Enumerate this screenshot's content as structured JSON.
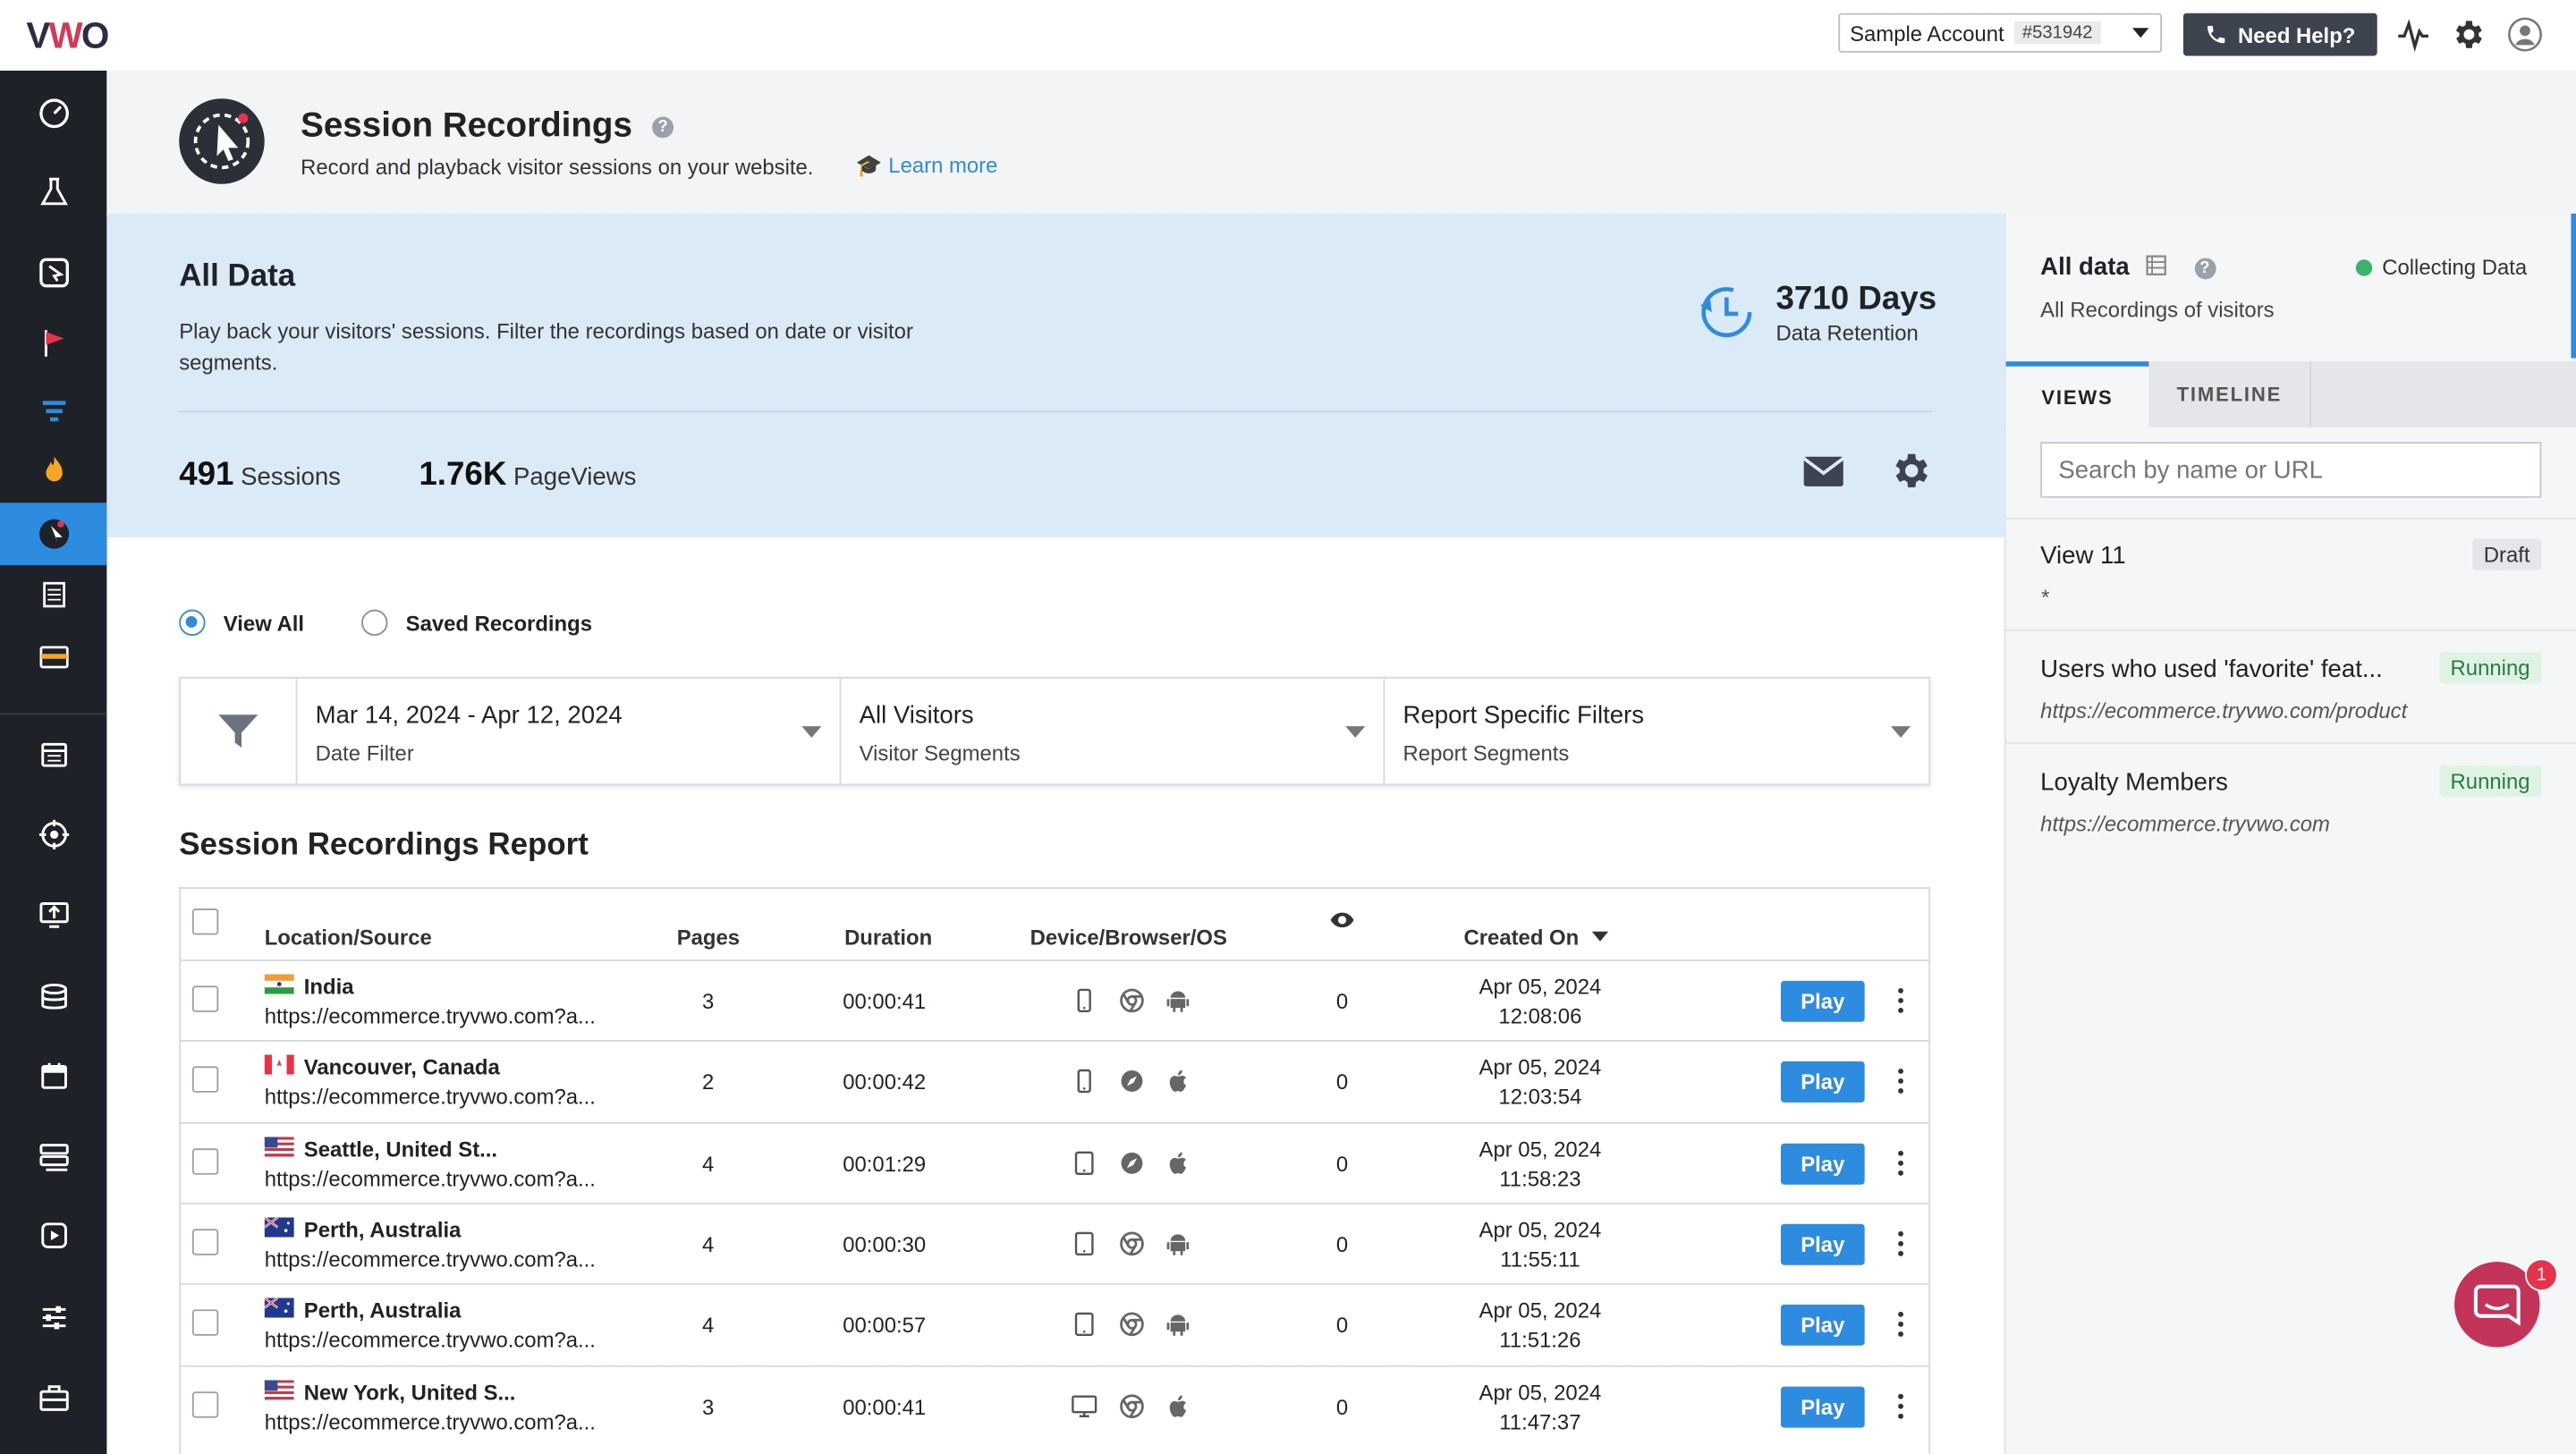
{
  "topbar": {
    "logo": "VWO",
    "account_name": "Sample Account",
    "account_id": "#531942",
    "help_label": "Need Help?"
  },
  "header": {
    "title": "Session Recordings",
    "help_icon": "?",
    "subtitle": "Record and playback visitor sessions on your website.",
    "learn_more": "Learn more"
  },
  "all_data": {
    "title": "All Data",
    "description": "Play back your visitors' sessions. Filter the recordings based on date or visitor segments.",
    "retention_value": "3710 Days",
    "retention_label": "Data Retention",
    "sessions_value": "491",
    "sessions_label": "Sessions",
    "pageviews_value": "1.76K",
    "pageviews_label": "PageViews"
  },
  "radios": {
    "view_all": "View All",
    "saved": "Saved Recordings"
  },
  "filters": [
    {
      "value": "Mar 14, 2024 - Apr 12, 2024",
      "label": "Date Filter"
    },
    {
      "value": "All Visitors",
      "label": "Visitor Segments"
    },
    {
      "value": "Report Specific Filters",
      "label": "Report Segments"
    }
  ],
  "report": {
    "title": "Session Recordings Report",
    "columns": {
      "location": "Location/Source",
      "pages": "Pages",
      "duration": "Duration",
      "device": "Device/Browser/OS",
      "created": "Created On"
    },
    "play_label": "Play",
    "rows": [
      {
        "location": "India",
        "source": "https://ecommerce.tryvwo.com?a...",
        "pages": "3",
        "duration": "00:00:41",
        "views": "0",
        "date": "Apr 05, 2024",
        "time": "12:08:06",
        "flag": "in",
        "device": "mobile",
        "browser": "chrome",
        "os": "android"
      },
      {
        "location": "Vancouver, Canada",
        "source": "https://ecommerce.tryvwo.com?a...",
        "pages": "2",
        "duration": "00:00:42",
        "views": "0",
        "date": "Apr 05, 2024",
        "time": "12:03:54",
        "flag": "ca",
        "device": "mobile",
        "browser": "safari",
        "os": "apple"
      },
      {
        "location": "Seattle, United St...",
        "source": "https://ecommerce.tryvwo.com?a...",
        "pages": "4",
        "duration": "00:01:29",
        "views": "0",
        "date": "Apr 05, 2024",
        "time": "11:58:23",
        "flag": "us",
        "device": "tablet",
        "browser": "safari",
        "os": "apple"
      },
      {
        "location": "Perth, Australia",
        "source": "https://ecommerce.tryvwo.com?a...",
        "pages": "4",
        "duration": "00:00:30",
        "views": "0",
        "date": "Apr 05, 2024",
        "time": "11:55:11",
        "flag": "au",
        "device": "tablet",
        "browser": "chrome",
        "os": "android"
      },
      {
        "location": "Perth, Australia",
        "source": "https://ecommerce.tryvwo.com?a...",
        "pages": "4",
        "duration": "00:00:57",
        "views": "0",
        "date": "Apr 05, 2024",
        "time": "11:51:26",
        "flag": "au",
        "device": "tablet",
        "browser": "chrome",
        "os": "android"
      },
      {
        "location": "New York, United S...",
        "source": "https://ecommerce.tryvwo.com?a...",
        "pages": "3",
        "duration": "00:00:41",
        "views": "0",
        "date": "Apr 05, 2024",
        "time": "11:47:37",
        "flag": "us",
        "device": "desktop",
        "browser": "chrome",
        "os": "apple"
      }
    ]
  },
  "right_panel": {
    "title": "All data",
    "subtitle": "All Recordings of visitors",
    "status": "Collecting Data",
    "tabs": [
      "VIEWS",
      "TIMELINE"
    ],
    "search_placeholder": "Search by name or URL",
    "views": [
      {
        "name": "View 11",
        "url": "*",
        "badge": "Draft"
      },
      {
        "name": "Users who used 'favorite' feat...",
        "url": "https://ecommerce.tryvwo.com/product",
        "badge": "Running"
      },
      {
        "name": "Loyalty Members",
        "url": "https://ecommerce.tryvwo.com",
        "badge": "Running"
      }
    ]
  },
  "chat": {
    "badge_count": "1"
  },
  "colors": {
    "accent": "#2d8be0",
    "sidebar": "#1e2127",
    "running": "#2c7a46",
    "chat": "#c4345a"
  },
  "sidebar_icons": [
    "dashboard-icon",
    "flask-icon",
    "cursor-icon",
    "flag-icon",
    "funnel-icon",
    "fire-icon",
    "recordings-icon",
    "forms-icon",
    "card-icon",
    "calendar-list-icon",
    "target-icon",
    "upload-icon",
    "database-icon",
    "calendar-icon",
    "stack-icon",
    "deploy-icon",
    "sliders-icon",
    "briefcase-icon"
  ]
}
